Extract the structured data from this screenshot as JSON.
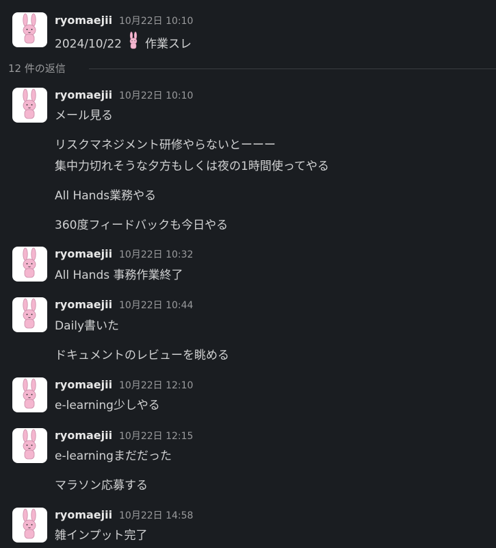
{
  "root_message": {
    "author": "ryomaejii",
    "timestamp": "10月22日 10:10",
    "date_text": "2024/10/22",
    "emoji": "bunny-emoji",
    "suffix_text": "作業スレ"
  },
  "thread": {
    "reply_count_label": "12 件の返信"
  },
  "messages": [
    {
      "author": "ryomaejii",
      "timestamp": "10月22日 10:10",
      "lines": [
        "メール見る",
        "リスクマネジメント研修やらないとーーー",
        "集中力切れそうな夕方もしくは夜の1時間使ってやる",
        "All Hands業務やる",
        "360度フィードバックも今日やる"
      ]
    },
    {
      "author": "ryomaejii",
      "timestamp": "10月22日 10:32",
      "lines": [
        "All Hands 事務作業終了"
      ]
    },
    {
      "author": "ryomaejii",
      "timestamp": "10月22日 10:44",
      "lines": [
        "Daily書いた",
        "ドキュメントのレビューを眺める"
      ]
    },
    {
      "author": "ryomaejii",
      "timestamp": "10月22日 12:10",
      "lines": [
        "e-learning少しやる"
      ]
    },
    {
      "author": "ryomaejii",
      "timestamp": "10月22日 12:15",
      "lines": [
        "e-learningまだだった",
        "マラソン応募する"
      ]
    },
    {
      "author": "ryomaejii",
      "timestamp": "10月22日 14:58",
      "lines": [
        "雑インプット完了"
      ]
    }
  ],
  "colors": {
    "background": "#1a1d21",
    "author": "#e8e8e8",
    "timestamp": "#9a9b9d",
    "text": "#d1d2d3",
    "avatar_bg": "#ffffff",
    "bunny": "#f4b6cf"
  }
}
